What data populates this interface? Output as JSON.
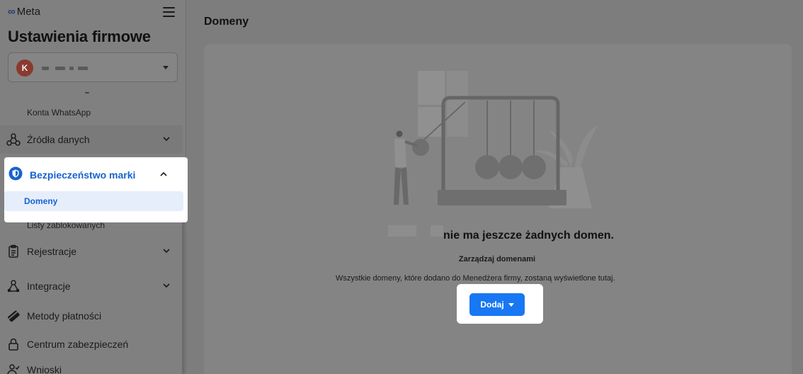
{
  "brand": {
    "logo_text": "Meta"
  },
  "sidebar": {
    "title": "Ustawienia firmowe",
    "account": {
      "avatar_letter": "K"
    },
    "items": [
      {
        "label": "Konta WhatsApp",
        "type": "subitem"
      },
      {
        "label": "Źródła danych",
        "icon": "data-sources-icon",
        "expandable": true,
        "expanded": false
      },
      {
        "label": "Bezpieczeństwo marki",
        "icon": "shield-icon",
        "expandable": true,
        "expanded": true,
        "active": true
      },
      {
        "label": "Domeny",
        "type": "subitem",
        "active": true
      },
      {
        "label": "Listy zablokowanych",
        "type": "subitem"
      },
      {
        "label": "Rejestracje",
        "icon": "clipboard-icon",
        "expandable": true,
        "expanded": false
      },
      {
        "label": "Integracje",
        "icon": "integrations-icon",
        "expandable": true,
        "expanded": false
      },
      {
        "label": "Metody płatności",
        "icon": "credit-card-icon",
        "expandable": false
      },
      {
        "label": "Centrum zabezpieczeń",
        "icon": "lock-icon",
        "expandable": false
      },
      {
        "label": "Wnioski",
        "icon": "person-check-icon",
        "expandable": false
      }
    ]
  },
  "main": {
    "title": "Domeny",
    "empty_state": {
      "heading": "nie ma jeszcze żadnych domen.",
      "subheading": "Zarządzaj domenami",
      "description": "Wszystkie domeny, które dodano do Menedżera firmy, zostaną wyświetlone tutaj.",
      "add_button_label": "Dodaj"
    }
  },
  "colors": {
    "accent": "#1877f2",
    "active_text": "#1763cf",
    "active_bg": "#e6eefb",
    "overlay_gray": "#7d7d7d"
  }
}
